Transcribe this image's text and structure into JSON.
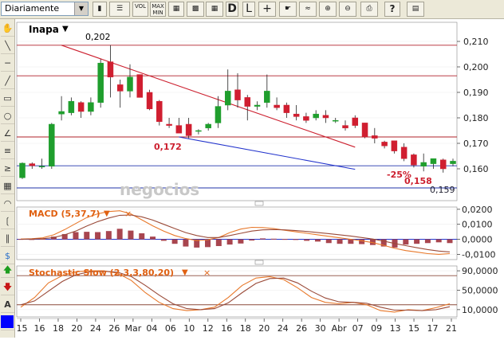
{
  "toolbar": {
    "period": "Diariamente",
    "vol_label": "VOL",
    "maxmin_label_1": "MAX",
    "maxmin_label_2": "MIN",
    "d_label": "D",
    "l_label": "L",
    "help_label": "?"
  },
  "chart_data": [
    {
      "type": "candlestick",
      "title": "Inapa",
      "price_ticks": [
        "0,210",
        "0,200",
        "0,190",
        "0,180",
        "0,170",
        "0,160"
      ],
      "annotations": [
        "0,202",
        "0,172",
        "-25%",
        "0,158",
        "0,159"
      ],
      "watermark": "negocios",
      "x_ticks": [
        "'15",
        "16",
        "18",
        "20",
        "24",
        "26",
        "Mar",
        "04",
        "06",
        "10",
        "12",
        "16",
        "18",
        "20",
        "24",
        "26",
        "30",
        "Abr",
        "07",
        "09",
        "13",
        "15",
        "17",
        "21"
      ],
      "horizontal_levels": [
        0.2085,
        0.1965,
        0.1725,
        0.1612,
        0.1525
      ],
      "trendlines": [
        {
          "from": [
            4,
            0.2085
          ],
          "to": [
            34,
            0.1685
          ],
          "color": "#cc1f2e"
        },
        {
          "from": [
            16,
            0.1725
          ],
          "to": [
            34,
            0.1598
          ],
          "color": "#2233cc"
        }
      ],
      "ylim": [
        0.1475,
        0.2175
      ],
      "candles": [
        {
          "o": 0.1565,
          "h": 0.1625,
          "l": 0.156,
          "c": 0.1622
        },
        {
          "o": 0.162,
          "h": 0.1625,
          "l": 0.16,
          "c": 0.1612
        },
        {
          "o": 0.161,
          "h": 0.164,
          "l": 0.16,
          "c": 0.161
        },
        {
          "o": 0.161,
          "h": 0.178,
          "l": 0.16,
          "c": 0.1775
        },
        {
          "o": 0.1815,
          "h": 0.1885,
          "l": 0.179,
          "c": 0.1825
        },
        {
          "o": 0.182,
          "h": 0.188,
          "l": 0.181,
          "c": 0.1865
        },
        {
          "o": 0.186,
          "h": 0.1865,
          "l": 0.18,
          "c": 0.1825
        },
        {
          "o": 0.1825,
          "h": 0.188,
          "l": 0.181,
          "c": 0.186
        },
        {
          "o": 0.186,
          "h": 0.203,
          "l": 0.184,
          "c": 0.2015
        },
        {
          "o": 0.202,
          "h": 0.2085,
          "l": 0.188,
          "c": 0.196
        },
        {
          "o": 0.193,
          "h": 0.195,
          "l": 0.184,
          "c": 0.1905
        },
        {
          "o": 0.1905,
          "h": 0.201,
          "l": 0.188,
          "c": 0.196
        },
        {
          "o": 0.197,
          "h": 0.197,
          "l": 0.188,
          "c": 0.188
        },
        {
          "o": 0.19,
          "h": 0.191,
          "l": 0.183,
          "c": 0.1835
        },
        {
          "o": 0.1865,
          "h": 0.187,
          "l": 0.177,
          "c": 0.1785
        },
        {
          "o": 0.1775,
          "h": 0.18,
          "l": 0.176,
          "c": 0.177
        },
        {
          "o": 0.177,
          "h": 0.18,
          "l": 0.174,
          "c": 0.174
        },
        {
          "o": 0.1775,
          "h": 0.18,
          "l": 0.172,
          "c": 0.173
        },
        {
          "o": 0.175,
          "h": 0.1755,
          "l": 0.1735,
          "c": 0.175
        },
        {
          "o": 0.176,
          "h": 0.178,
          "l": 0.175,
          "c": 0.1775
        },
        {
          "o": 0.178,
          "h": 0.1885,
          "l": 0.176,
          "c": 0.1845
        },
        {
          "o": 0.185,
          "h": 0.199,
          "l": 0.183,
          "c": 0.1905
        },
        {
          "o": 0.191,
          "h": 0.1975,
          "l": 0.184,
          "c": 0.187
        },
        {
          "o": 0.188,
          "h": 0.189,
          "l": 0.179,
          "c": 0.1845
        },
        {
          "o": 0.1845,
          "h": 0.1865,
          "l": 0.183,
          "c": 0.185
        },
        {
          "o": 0.186,
          "h": 0.197,
          "l": 0.184,
          "c": 0.1905
        },
        {
          "o": 0.185,
          "h": 0.188,
          "l": 0.183,
          "c": 0.184
        },
        {
          "o": 0.185,
          "h": 0.186,
          "l": 0.18,
          "c": 0.182
        },
        {
          "o": 0.1815,
          "h": 0.185,
          "l": 0.179,
          "c": 0.1805
        },
        {
          "o": 0.1805,
          "h": 0.182,
          "l": 0.178,
          "c": 0.179
        },
        {
          "o": 0.18,
          "h": 0.183,
          "l": 0.179,
          "c": 0.1815
        },
        {
          "o": 0.181,
          "h": 0.183,
          "l": 0.178,
          "c": 0.18
        },
        {
          "o": 0.179,
          "h": 0.18,
          "l": 0.178,
          "c": 0.179
        },
        {
          "o": 0.177,
          "h": 0.179,
          "l": 0.175,
          "c": 0.176
        },
        {
          "o": 0.18,
          "h": 0.181,
          "l": 0.176,
          "c": 0.177
        },
        {
          "o": 0.178,
          "h": 0.178,
          "l": 0.172,
          "c": 0.1725
        },
        {
          "o": 0.173,
          "h": 0.176,
          "l": 0.17,
          "c": 0.172
        },
        {
          "o": 0.1705,
          "h": 0.171,
          "l": 0.168,
          "c": 0.169
        },
        {
          "o": 0.171,
          "h": 0.171,
          "l": 0.166,
          "c": 0.167
        },
        {
          "o": 0.1685,
          "h": 0.17,
          "l": 0.163,
          "c": 0.164
        },
        {
          "o": 0.1655,
          "h": 0.166,
          "l": 0.1605,
          "c": 0.1615
        },
        {
          "o": 0.161,
          "h": 0.166,
          "l": 0.159,
          "c": 0.1625
        },
        {
          "o": 0.162,
          "h": 0.164,
          "l": 0.16,
          "c": 0.164
        },
        {
          "o": 0.1635,
          "h": 0.164,
          "l": 0.1585,
          "c": 0.16
        },
        {
          "o": 0.162,
          "h": 0.164,
          "l": 0.161,
          "c": 0.163
        }
      ]
    },
    {
      "type": "bar",
      "title": "MACD (5,37,7)",
      "y_ticks": [
        "0,0200",
        "0,0100",
        "0,0000",
        "-0,0100"
      ],
      "ylim": [
        -0.0135,
        0.0215
      ],
      "histogram": [
        0.0002,
        0.0001,
        0.0003,
        0.0018,
        0.0035,
        0.0048,
        0.005,
        0.0048,
        0.0055,
        0.007,
        0.0058,
        0.004,
        0.0018,
        -0.001,
        -0.003,
        -0.0048,
        -0.0055,
        -0.0052,
        -0.0045,
        -0.0035,
        -0.0028,
        -0.0008,
        0.0006,
        0.0004,
        0.0002,
        0.0001,
        -0.001,
        -0.0015,
        -0.0025,
        -0.003,
        -0.003,
        -0.0032,
        -0.0038,
        -0.0048,
        -0.0055,
        -0.0035,
        -0.003,
        -0.0025,
        -0.002,
        -0.0025
      ],
      "macd_line": [
        0.0002,
        0.0004,
        0.001,
        0.003,
        0.0065,
        0.0105,
        0.0145,
        0.017,
        0.0185,
        0.019,
        0.017,
        0.013,
        0.009,
        0.0055,
        0.0025,
        0.0005,
        -0.0008,
        -0.0003,
        0.0012,
        0.0045,
        0.0068,
        0.008,
        0.0078,
        0.0072,
        0.006,
        0.005,
        0.004,
        0.003,
        0.002,
        0.001,
        0.0,
        -0.001,
        -0.0022,
        -0.004,
        -0.006,
        -0.0075,
        -0.0085,
        -0.0095,
        -0.01,
        -0.0095
      ],
      "signal_line": [
        0.0,
        0.0002,
        0.0004,
        0.0012,
        0.003,
        0.0055,
        0.0088,
        0.0118,
        0.0142,
        0.016,
        0.0162,
        0.015,
        0.0128,
        0.01,
        0.0072,
        0.0045,
        0.0025,
        0.0012,
        0.0012,
        0.0025,
        0.004,
        0.0055,
        0.0063,
        0.0065,
        0.0063,
        0.0058,
        0.0052,
        0.0045,
        0.0038,
        0.003,
        0.0022,
        0.0012,
        0.0002,
        -0.0012,
        -0.0028,
        -0.0042,
        -0.0056,
        -0.0068,
        -0.0078,
        -0.0084
      ]
    },
    {
      "type": "line",
      "title": "Stochastic Slow (2,3,3,80,20)",
      "y_ticks": [
        "90,0000",
        "50,0000",
        "10,0000"
      ],
      "ylim": [
        -5,
        100
      ],
      "levels": [
        80,
        20
      ],
      "k_line": [
        15,
        35,
        65,
        80,
        88,
        90,
        90,
        85,
        70,
        45,
        25,
        12,
        8,
        10,
        15,
        35,
        60,
        75,
        78,
        72,
        55,
        35,
        25,
        22,
        25,
        20,
        8,
        5,
        10,
        8,
        14,
        22
      ],
      "d_line": [
        20,
        28,
        48,
        68,
        82,
        88,
        89,
        87,
        78,
        60,
        40,
        22,
        12,
        10,
        12,
        24,
        45,
        64,
        74,
        75,
        65,
        48,
        34,
        26,
        25,
        23,
        15,
        9,
        9,
        8,
        10,
        16
      ]
    }
  ]
}
